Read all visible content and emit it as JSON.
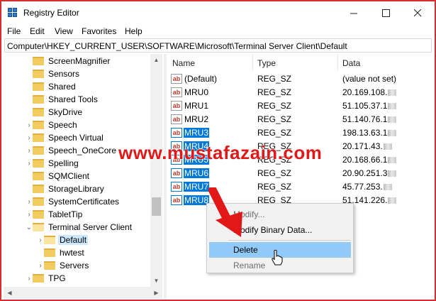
{
  "window": {
    "title": "Registry Editor",
    "minimize_icon": "minimize-icon",
    "maximize_icon": "maximize-icon",
    "close_icon": "close-icon"
  },
  "menu": [
    "File",
    "Edit",
    "View",
    "Favorites",
    "Help"
  ],
  "address": "Computer\\HKEY_CURRENT_USER\\SOFTWARE\\Microsoft\\Terminal Server Client\\Default",
  "tree": {
    "items": [
      {
        "label": "ScreenMagnifier",
        "chevron": ""
      },
      {
        "label": "Sensors",
        "chevron": ""
      },
      {
        "label": "Shared",
        "chevron": ""
      },
      {
        "label": "Shared Tools",
        "chevron": ""
      },
      {
        "label": "SkyDrive",
        "chevron": ""
      },
      {
        "label": "Speech",
        "chevron": "›"
      },
      {
        "label": "Speech Virtual",
        "chevron": "›"
      },
      {
        "label": "Speech_OneCore",
        "chevron": "›"
      },
      {
        "label": "Spelling",
        "chevron": "›"
      },
      {
        "label": "SQMClient",
        "chevron": ""
      },
      {
        "label": "StorageLibrary",
        "chevron": ""
      },
      {
        "label": "SystemCertificates",
        "chevron": "›"
      },
      {
        "label": "TabletTip",
        "chevron": "›"
      },
      {
        "label": "Terminal Server Client",
        "chevron": "⌄"
      },
      {
        "label": "Default",
        "chevron": "›"
      },
      {
        "label": "hwtest",
        "chevron": ""
      },
      {
        "label": "Servers",
        "chevron": "›"
      },
      {
        "label": "TPG",
        "chevron": "›"
      }
    ]
  },
  "list": {
    "columns": [
      "Name",
      "Type",
      "Data"
    ],
    "rows": [
      {
        "name": "(Default)",
        "type": "REG_SZ",
        "data": "(value not set)"
      },
      {
        "name": "MRU0",
        "type": "REG_SZ",
        "data": "20.169.108."
      },
      {
        "name": "MRU1",
        "type": "REG_SZ",
        "data": "51.105.37.1"
      },
      {
        "name": "MRU2",
        "type": "REG_SZ",
        "data": "51.140.76.1"
      },
      {
        "name": "MRU3",
        "type": "REG_SZ",
        "data": "198.13.63.1"
      },
      {
        "name": "MRU4",
        "type": "REG_SZ",
        "data": "20.171.43."
      },
      {
        "name": "MRU5",
        "type": "REG_SZ",
        "data": "20.168.66.1"
      },
      {
        "name": "MRU6",
        "type": "REG_SZ",
        "data": "20.90.251.3"
      },
      {
        "name": "MRU7",
        "type": "REG_SZ",
        "data": "45.77.253."
      },
      {
        "name": "MRU8",
        "type": "REG_SZ",
        "data": "51.141.226."
      }
    ]
  },
  "context_menu": {
    "items": [
      "Modify...",
      "Modify Binary Data...",
      "Delete",
      "Rename"
    ]
  },
  "watermark": "www.mustafazain.com",
  "colors": {
    "selection": "#0078d7",
    "menu_hover": "#91c9f7",
    "watermark": "#e01818",
    "arrow": "#e01818"
  }
}
